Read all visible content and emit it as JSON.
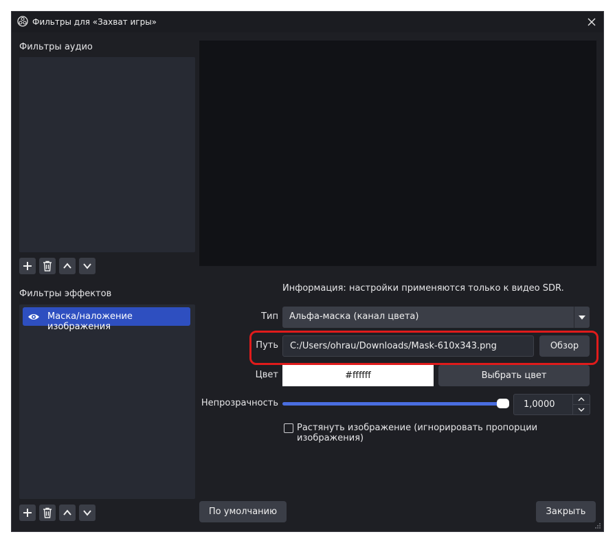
{
  "window": {
    "title": "Фильтры для «Захват игры»",
    "icon": "obs-logo-icon",
    "close_icon": "close-icon"
  },
  "audio_filters": {
    "label": "Фильтры аудио",
    "items": [],
    "toolbar": [
      "add-icon",
      "trash-icon",
      "chevron-up-icon",
      "chevron-down-icon"
    ]
  },
  "effect_filters": {
    "label": "Фильтры эффектов",
    "items": [
      {
        "label": "Маска/наложение изображения",
        "visible": true,
        "selected": true
      }
    ],
    "toolbar": [
      "add-icon",
      "trash-icon",
      "chevron-up-icon",
      "chevron-down-icon"
    ]
  },
  "properties": {
    "info": "Информация: настройки применяются только к видео SDR.",
    "type_label": "Тип",
    "type_value": "Альфа-маска (канал цвета)",
    "path_label": "Путь",
    "path_value": "C:/Users/ohrau/Downloads/Mask-610x343.png",
    "browse_label": "Обзор",
    "color_label": "Цвет",
    "color_value": "#ffffff",
    "pick_color_label": "Выбрать цвет",
    "opacity_label": "Непрозрачность",
    "opacity_value": "1,0000",
    "opacity_fraction": 1.0,
    "stretch_label": "Растянуть изображение (игнорировать пропорции изображения)",
    "stretch_checked": false
  },
  "footer": {
    "defaults_label": "По умолчанию",
    "close_label": "Закрыть"
  },
  "colors": {
    "accent": "#2e4fc0",
    "highlight": "#e01b1b",
    "slider": "#4a6ee0"
  }
}
